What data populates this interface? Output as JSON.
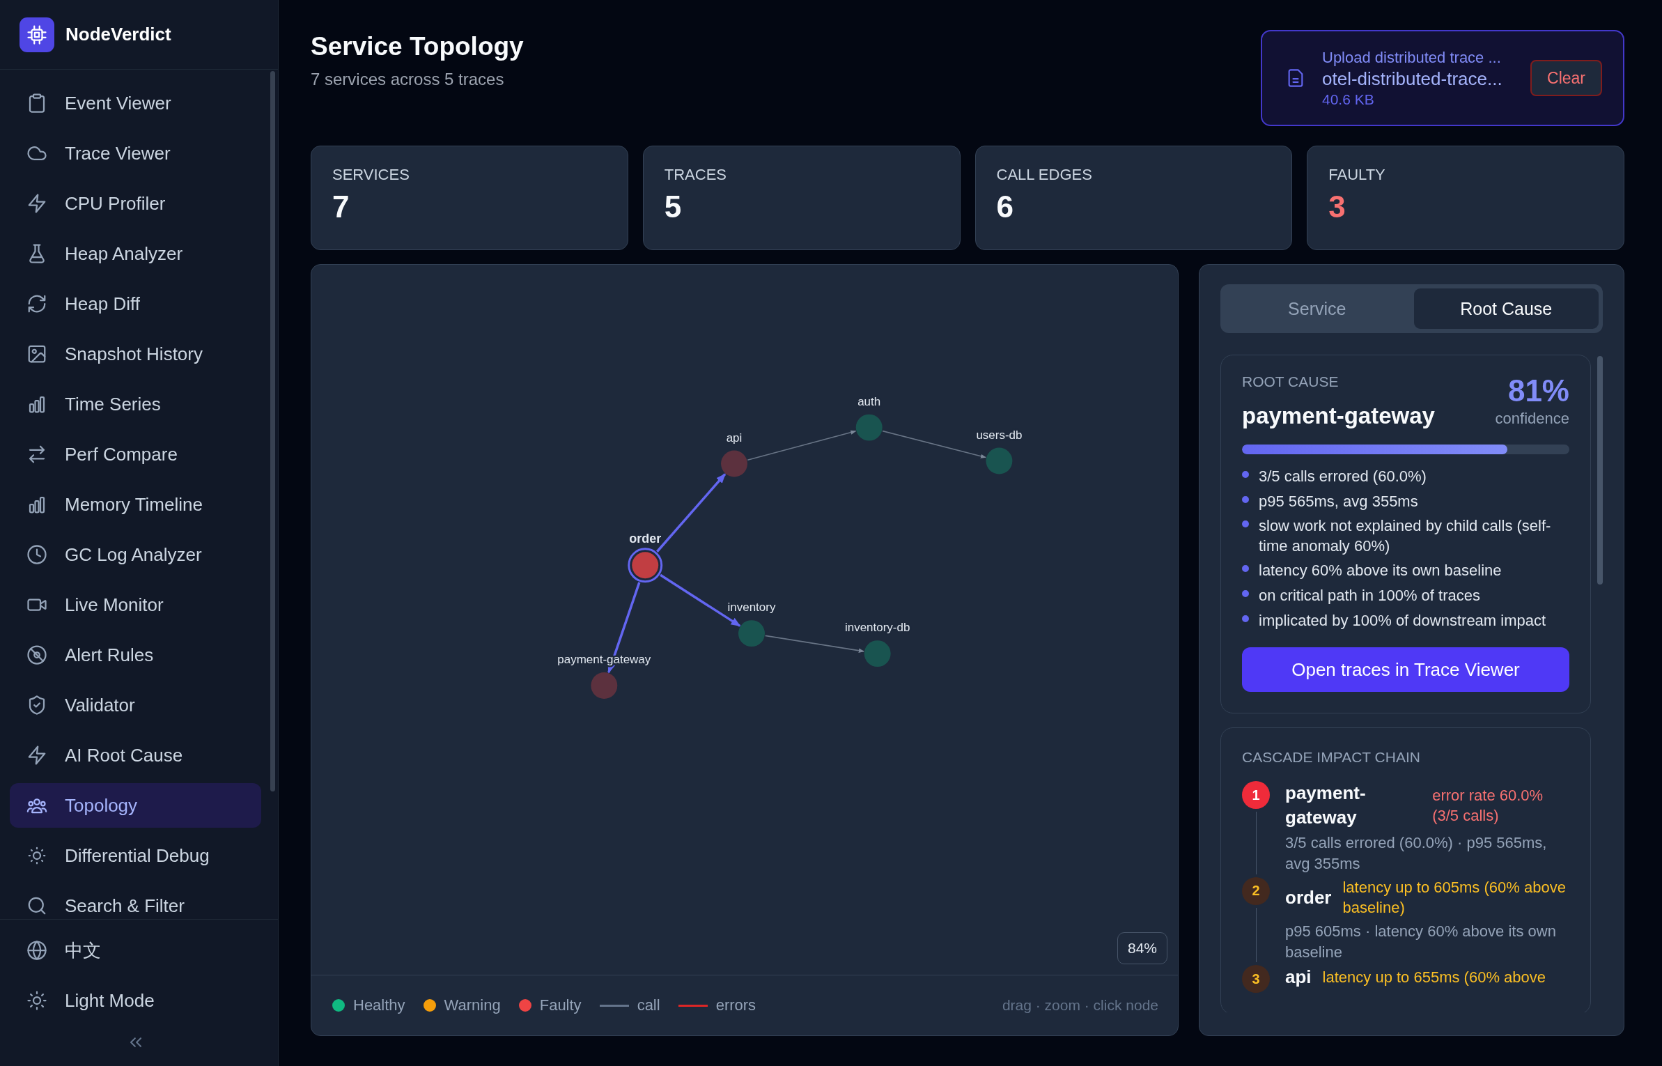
{
  "app": {
    "name": "NodeVerdict"
  },
  "sidebar": {
    "items": [
      {
        "label": "Event Viewer",
        "selected": false
      },
      {
        "label": "Trace Viewer",
        "selected": false
      },
      {
        "label": "CPU Profiler",
        "selected": false
      },
      {
        "label": "Heap Analyzer",
        "selected": false
      },
      {
        "label": "Heap Diff",
        "selected": false
      },
      {
        "label": "Snapshot History",
        "selected": false
      },
      {
        "label": "Time Series",
        "selected": false
      },
      {
        "label": "Perf Compare",
        "selected": false
      },
      {
        "label": "Memory Timeline",
        "selected": false
      },
      {
        "label": "GC Log Analyzer",
        "selected": false
      },
      {
        "label": "Live Monitor",
        "selected": false
      },
      {
        "label": "Alert Rules",
        "selected": false
      },
      {
        "label": "Validator",
        "selected": false
      },
      {
        "label": "AI Root Cause",
        "selected": false
      },
      {
        "label": "Topology",
        "selected": true
      },
      {
        "label": "Differential Debug",
        "selected": false
      },
      {
        "label": "Search & Filter",
        "selected": false
      }
    ],
    "footer": [
      {
        "label": "中文",
        "kind": "language"
      },
      {
        "label": "Light Mode",
        "kind": "theme"
      }
    ]
  },
  "header": {
    "title": "Service Topology",
    "subtitle": "7 services across 5 traces"
  },
  "upload": {
    "prompt": "Upload distributed trace ...",
    "file_name": "otel-distributed-trace...",
    "file_size": "40.6 KB",
    "button": "Clear"
  },
  "stats": [
    {
      "label": "SERVICES",
      "value": "7",
      "kind": "normal"
    },
    {
      "label": "TRACES",
      "value": "5",
      "kind": "normal"
    },
    {
      "label": "CALL EDGES",
      "value": "6",
      "kind": "normal"
    },
    {
      "label": "FAULTY",
      "value": "3",
      "kind": "alert"
    }
  ],
  "graph": {
    "nodes": [
      {
        "name": "auth",
        "kind": "healthy",
        "selected": false
      },
      {
        "name": "api",
        "kind": "faulty",
        "selected": false
      },
      {
        "name": "users-db",
        "kind": "healthy",
        "selected": false
      },
      {
        "name": "order",
        "kind": "faulty",
        "selected": true
      },
      {
        "name": "inventory",
        "kind": "healthy",
        "selected": false
      },
      {
        "name": "inventory-db",
        "kind": "healthy",
        "selected": false
      },
      {
        "name": "payment-gateway",
        "kind": "faulty",
        "selected": false
      }
    ],
    "edges": [
      {
        "kind": "call",
        "highlighted": false
      },
      {
        "kind": "call",
        "highlighted": false
      },
      {
        "kind": "call",
        "highlighted": true
      },
      {
        "kind": "call",
        "highlighted": true
      },
      {
        "kind": "call",
        "highlighted": true
      },
      {
        "kind": "call",
        "highlighted": false
      }
    ],
    "zoom": "84%",
    "legend": [
      {
        "label": "Healthy",
        "kind": "dot",
        "color": "#10b981"
      },
      {
        "label": "Warning",
        "kind": "dot",
        "color": "#f59e0b"
      },
      {
        "label": "Faulty",
        "kind": "dot",
        "color": "#ef4444"
      },
      {
        "label": "call",
        "kind": "line",
        "color": "#64748b"
      },
      {
        "label": "errors",
        "kind": "line",
        "color": "#dc2626"
      }
    ],
    "hint": "drag · zoom · click node"
  },
  "panel": {
    "tabs": [
      {
        "label": "Service",
        "selected": false
      },
      {
        "label": "Root Cause",
        "selected": true
      }
    ],
    "root_cause": {
      "heading": "ROOT CAUSE",
      "service": "payment-gateway",
      "confidence": "81%",
      "confidence_label": "confidence",
      "level": 0.81,
      "findings": [
        "3/5 calls errored (60.0%)",
        "p95 565ms, avg 355ms",
        "slow work not explained by child calls (self-time anomaly 60%)",
        "latency 60% above its own baseline",
        "on critical path in 100% of traces",
        "implicated by 100% of downstream impact"
      ],
      "button": "Open traces in Trace Viewer"
    },
    "cascade": {
      "heading": "CASCADE IMPACT CHAIN",
      "items": [
        {
          "rank": "1",
          "service": "payment-gateway",
          "kind": "faulty",
          "note": "error rate 60.0% (3/5 calls)",
          "detail": "3/5 calls errored (60.0%) · p95 565ms, avg 355ms"
        },
        {
          "rank": "2",
          "service": "order",
          "kind": "warning",
          "note": "latency up to 605ms (60% above baseline)",
          "detail": "p95 605ms · latency 60% above its own baseline"
        },
        {
          "rank": "3",
          "service": "api",
          "kind": "warning",
          "note": "latency up to 655ms (60% above"
        }
      ]
    }
  }
}
